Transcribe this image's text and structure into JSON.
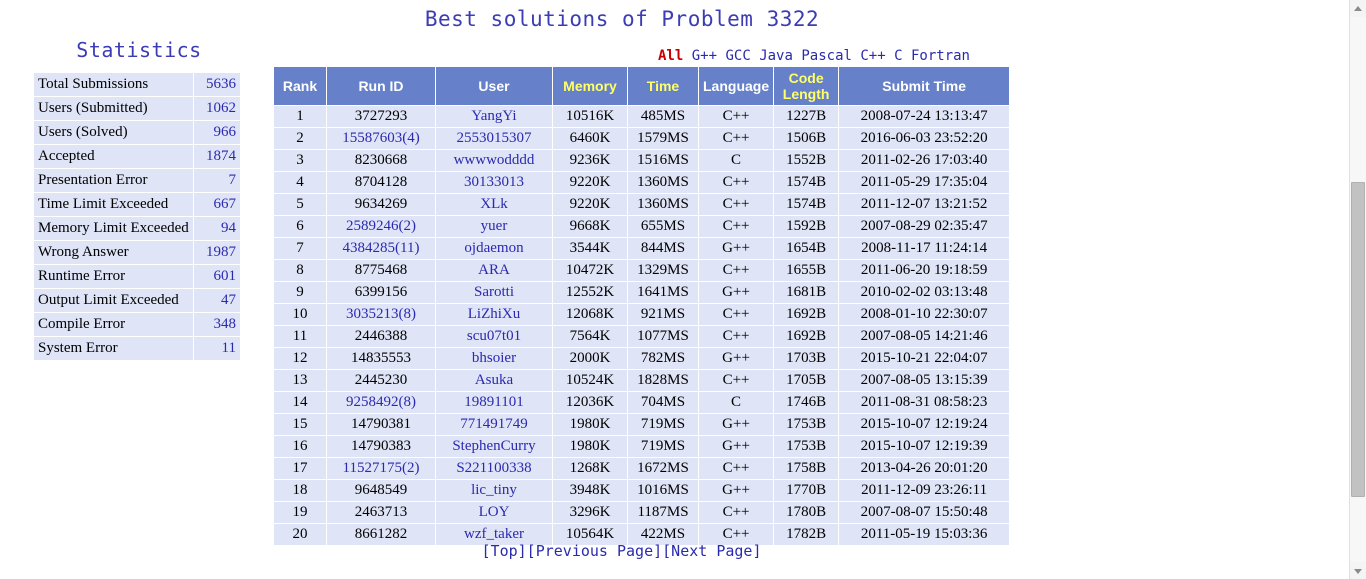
{
  "page": {
    "title": "Best solutions of Problem 3322"
  },
  "statistics": {
    "heading": "Statistics",
    "rows": [
      {
        "label": "Total Submissions",
        "value": "5636"
      },
      {
        "label": "Users (Submitted)",
        "value": "1062"
      },
      {
        "label": "Users (Solved)",
        "value": "966"
      },
      {
        "label": "Accepted",
        "value": "1874"
      },
      {
        "label": "Presentation Error",
        "value": "7"
      },
      {
        "label": "Time Limit Exceeded",
        "value": "667"
      },
      {
        "label": "Memory Limit Exceeded",
        "value": "94"
      },
      {
        "label": "Wrong Answer",
        "value": "1987"
      },
      {
        "label": "Runtime Error",
        "value": "601"
      },
      {
        "label": "Output Limit Exceeded",
        "value": "47"
      },
      {
        "label": "Compile Error",
        "value": "348"
      },
      {
        "label": "System Error",
        "value": "11"
      }
    ]
  },
  "language_filter": {
    "selected": "All",
    "options": [
      "All",
      "G++",
      "GCC",
      "Java",
      "Pascal",
      "C++",
      "C",
      "Fortran"
    ],
    "selected_color": "#cc0000",
    "link_color": "#2a2ab0"
  },
  "solutions_table": {
    "headers": [
      {
        "label": "Rank",
        "highlight": false
      },
      {
        "label": "Run ID",
        "highlight": false
      },
      {
        "label": "User",
        "highlight": false
      },
      {
        "label": "Memory",
        "highlight": true
      },
      {
        "label": "Time",
        "highlight": true
      },
      {
        "label": "Language",
        "highlight": false
      },
      {
        "label": "Code Length",
        "highlight": true
      },
      {
        "label": "Submit Time",
        "highlight": false
      }
    ],
    "header_bg": "#6680c9",
    "row_bg": "#dfe4f7",
    "rows": [
      {
        "rank": "1",
        "run_id": "3727293",
        "run_id_link": false,
        "user": "YangYi",
        "memory": "10516K",
        "time": "485MS",
        "language": "C++",
        "code_length": "1227B",
        "submit_time": "2008-07-24 13:13:47"
      },
      {
        "rank": "2",
        "run_id": "15587603(4)",
        "run_id_link": true,
        "user": "2553015307",
        "memory": "6460K",
        "time": "1579MS",
        "language": "C++",
        "code_length": "1506B",
        "submit_time": "2016-06-03 23:52:20"
      },
      {
        "rank": "3",
        "run_id": "8230668",
        "run_id_link": false,
        "user": "wwwwodddd",
        "memory": "9236K",
        "time": "1516MS",
        "language": "C",
        "code_length": "1552B",
        "submit_time": "2011-02-26 17:03:40"
      },
      {
        "rank": "4",
        "run_id": "8704128",
        "run_id_link": false,
        "user": "30133013",
        "memory": "9220K",
        "time": "1360MS",
        "language": "C++",
        "code_length": "1574B",
        "submit_time": "2011-05-29 17:35:04"
      },
      {
        "rank": "5",
        "run_id": "9634269",
        "run_id_link": false,
        "user": "XLk",
        "memory": "9220K",
        "time": "1360MS",
        "language": "C++",
        "code_length": "1574B",
        "submit_time": "2011-12-07 13:21:52"
      },
      {
        "rank": "6",
        "run_id": "2589246(2)",
        "run_id_link": true,
        "user": "yuer",
        "memory": "9668K",
        "time": "655MS",
        "language": "C++",
        "code_length": "1592B",
        "submit_time": "2007-08-29 02:35:47"
      },
      {
        "rank": "7",
        "run_id": "4384285(11)",
        "run_id_link": true,
        "user": "ojdaemon",
        "memory": "3544K",
        "time": "844MS",
        "language": "G++",
        "code_length": "1654B",
        "submit_time": "2008-11-17 11:24:14"
      },
      {
        "rank": "8",
        "run_id": "8775468",
        "run_id_link": false,
        "user": "ARA",
        "memory": "10472K",
        "time": "1329MS",
        "language": "C++",
        "code_length": "1655B",
        "submit_time": "2011-06-20 19:18:59"
      },
      {
        "rank": "9",
        "run_id": "6399156",
        "run_id_link": false,
        "user": "Sarotti",
        "memory": "12552K",
        "time": "1641MS",
        "language": "G++",
        "code_length": "1681B",
        "submit_time": "2010-02-02 03:13:48"
      },
      {
        "rank": "10",
        "run_id": "3035213(8)",
        "run_id_link": true,
        "user": "LiZhiXu",
        "memory": "12068K",
        "time": "921MS",
        "language": "C++",
        "code_length": "1692B",
        "submit_time": "2008-01-10 22:30:07"
      },
      {
        "rank": "11",
        "run_id": "2446388",
        "run_id_link": false,
        "user": "scu07t01",
        "memory": "7564K",
        "time": "1077MS",
        "language": "C++",
        "code_length": "1692B",
        "submit_time": "2007-08-05 14:21:46"
      },
      {
        "rank": "12",
        "run_id": "14835553",
        "run_id_link": false,
        "user": "bhsoier",
        "memory": "2000K",
        "time": "782MS",
        "language": "G++",
        "code_length": "1703B",
        "submit_time": "2015-10-21 22:04:07"
      },
      {
        "rank": "13",
        "run_id": "2445230",
        "run_id_link": false,
        "user": "Asuka",
        "memory": "10524K",
        "time": "1828MS",
        "language": "C++",
        "code_length": "1705B",
        "submit_time": "2007-08-05 13:15:39"
      },
      {
        "rank": "14",
        "run_id": "9258492(8)",
        "run_id_link": true,
        "user": "19891101",
        "memory": "12036K",
        "time": "704MS",
        "language": "C",
        "code_length": "1746B",
        "submit_time": "2011-08-31 08:58:23"
      },
      {
        "rank": "15",
        "run_id": "14790381",
        "run_id_link": false,
        "user": "771491749",
        "memory": "1980K",
        "time": "719MS",
        "language": "G++",
        "code_length": "1753B",
        "submit_time": "2015-10-07 12:19:24"
      },
      {
        "rank": "16",
        "run_id": "14790383",
        "run_id_link": false,
        "user": "StephenCurry",
        "memory": "1980K",
        "time": "719MS",
        "language": "G++",
        "code_length": "1753B",
        "submit_time": "2015-10-07 12:19:39"
      },
      {
        "rank": "17",
        "run_id": "11527175(2)",
        "run_id_link": true,
        "user": "S221100338",
        "memory": "1268K",
        "time": "1672MS",
        "language": "C++",
        "code_length": "1758B",
        "submit_time": "2013-04-26 20:01:20"
      },
      {
        "rank": "18",
        "run_id": "9648549",
        "run_id_link": false,
        "user": "lic_tiny",
        "memory": "3948K",
        "time": "1016MS",
        "language": "G++",
        "code_length": "1770B",
        "submit_time": "2011-12-09 23:26:11"
      },
      {
        "rank": "19",
        "run_id": "2463713",
        "run_id_link": false,
        "user": "LOY",
        "memory": "3296K",
        "time": "1187MS",
        "language": "C++",
        "code_length": "1780B",
        "submit_time": "2007-08-07 15:50:48"
      },
      {
        "rank": "20",
        "run_id": "8661282",
        "run_id_link": false,
        "user": "wzf_taker",
        "memory": "10564K",
        "time": "422MS",
        "language": "C++",
        "code_length": "1782B",
        "submit_time": "2011-05-19 15:03:36"
      }
    ]
  },
  "footer": {
    "links": [
      "[Top]",
      "[Previous Page]",
      "[Next Page]"
    ]
  },
  "scrollbar": {
    "up_arrow": "scroll-up-arrow",
    "down_arrow": "scroll-down-arrow"
  }
}
